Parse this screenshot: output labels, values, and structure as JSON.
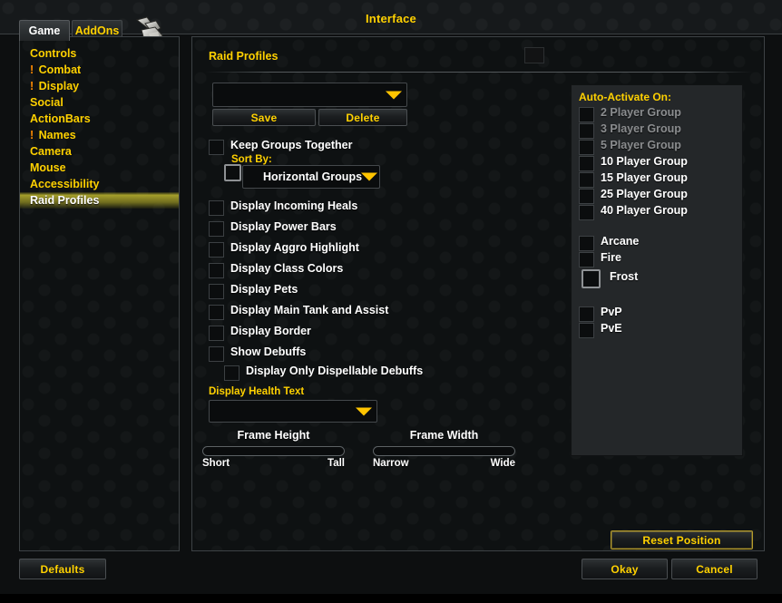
{
  "window": {
    "title": "Interface"
  },
  "tabs": [
    {
      "label": "Game",
      "active": true
    },
    {
      "label": "AddOns",
      "active": false
    }
  ],
  "sidebar": {
    "items": [
      {
        "label": "Controls",
        "alert": false,
        "selected": false
      },
      {
        "label": "Combat",
        "alert": true,
        "selected": false
      },
      {
        "label": "Display",
        "alert": true,
        "selected": false
      },
      {
        "label": "Social",
        "alert": false,
        "selected": false
      },
      {
        "label": "ActionBars",
        "alert": false,
        "selected": false
      },
      {
        "label": "Names",
        "alert": true,
        "selected": false
      },
      {
        "label": "Camera",
        "alert": false,
        "selected": false
      },
      {
        "label": "Mouse",
        "alert": false,
        "selected": false
      },
      {
        "label": "Accessibility",
        "alert": false,
        "selected": false
      },
      {
        "label": "Raid Profiles",
        "alert": false,
        "selected": true
      }
    ],
    "alert_glyph": "!"
  },
  "panel": {
    "title": "Raid Profiles",
    "profile_dropdown": {
      "value": "",
      "placeholder": ""
    },
    "save_label": "Save",
    "delete_label": "Delete",
    "keep_groups_together": {
      "label": "Keep Groups Together",
      "checked": false
    },
    "sort_by_label": "Sort By:",
    "sort_by_dropdown": {
      "value": "Horizontal Groups"
    },
    "sort_by_checkbox": {
      "checked": false
    },
    "options": [
      {
        "label": "Display Incoming Heals",
        "checked": false
      },
      {
        "label": "Display Power Bars",
        "checked": false
      },
      {
        "label": "Display Aggro Highlight",
        "checked": false
      },
      {
        "label": "Display Class Colors",
        "checked": false
      },
      {
        "label": "Display Pets",
        "checked": false
      },
      {
        "label": "Display Main Tank and Assist",
        "checked": false
      },
      {
        "label": "Display Border",
        "checked": false
      },
      {
        "label": "Show Debuffs",
        "checked": false
      }
    ],
    "dispellable": {
      "label": "Display Only Dispellable Debuffs",
      "checked": false
    },
    "health_text_label": "Display Health Text",
    "health_text_dropdown": {
      "value": ""
    },
    "frame_height_slider": {
      "name": "Frame Height",
      "low": "Short",
      "high": "Tall"
    },
    "frame_width_slider": {
      "name": "Frame Width",
      "low": "Narrow",
      "high": "Wide"
    },
    "reset_position_label": "Reset Position"
  },
  "auto_activate": {
    "title": "Auto-Activate On:",
    "group_sizes": [
      {
        "label": "2 Player Group",
        "checked": false,
        "disabled": true
      },
      {
        "label": "3 Player Group",
        "checked": false,
        "disabled": true
      },
      {
        "label": "5 Player Group",
        "checked": false,
        "disabled": true
      },
      {
        "label": "10 Player Group",
        "checked": false,
        "disabled": false
      },
      {
        "label": "15 Player Group",
        "checked": false,
        "disabled": false
      },
      {
        "label": "25 Player Group",
        "checked": false,
        "disabled": false
      },
      {
        "label": "40 Player Group",
        "checked": false,
        "disabled": false
      }
    ],
    "specs": [
      {
        "label": "Arcane",
        "checked": false,
        "highlighted": false
      },
      {
        "label": "Fire",
        "checked": false,
        "highlighted": false
      },
      {
        "label": "Frost",
        "checked": false,
        "highlighted": true
      }
    ],
    "modes": [
      {
        "label": "PvP",
        "checked": false
      },
      {
        "label": "PvE",
        "checked": false
      }
    ]
  },
  "footer": {
    "defaults_label": "Defaults",
    "okay_label": "Okay",
    "cancel_label": "Cancel"
  },
  "colors": {
    "gold": "#ffd100",
    "alert_orange": "#ff8a00",
    "white": "#ffffff",
    "disabled_gray": "#8b8d8f",
    "panel_border": "#3d4245",
    "selection_olive": "#c4bc30"
  }
}
